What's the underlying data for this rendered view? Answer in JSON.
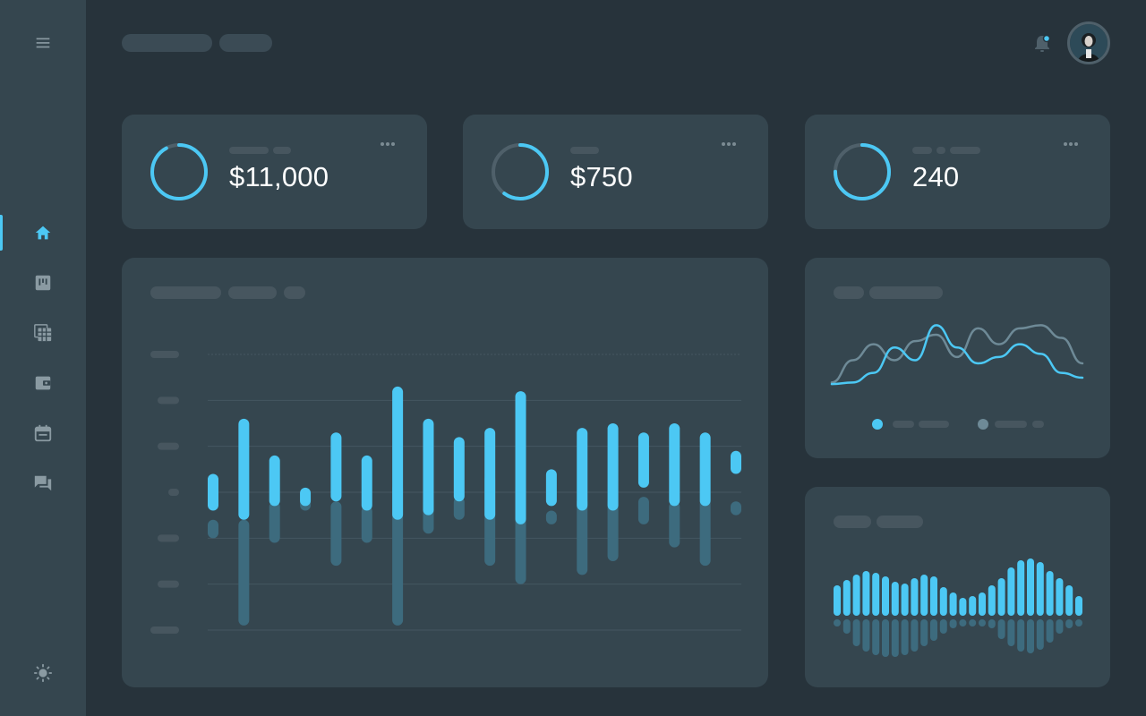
{
  "colors": {
    "accent": "#4cc8f4",
    "muted_series": "#3d6b7e",
    "background": "#27333b",
    "panel": "#35464f",
    "placeholder": "#47565f"
  },
  "sidebar": {
    "items": [
      {
        "icon": "menu-icon"
      },
      {
        "icon": "home-icon",
        "active": true
      },
      {
        "icon": "board-icon"
      },
      {
        "icon": "table-icon"
      },
      {
        "icon": "wallet-icon"
      },
      {
        "icon": "calendar-icon"
      },
      {
        "icon": "chat-icon"
      },
      {
        "icon": "brightness-icon"
      }
    ]
  },
  "header": {
    "notification_icon": "bell-icon",
    "notification_badge": true,
    "avatar": "user-avatar"
  },
  "stats": [
    {
      "value": "$11,000",
      "ring_progress": 0.92,
      "icon": "more-icon"
    },
    {
      "value": "$750",
      "ring_progress": 0.6,
      "icon": "more-icon"
    },
    {
      "value": "240",
      "ring_progress": 0.75,
      "icon": "more-icon"
    }
  ],
  "chart_data": [
    {
      "type": "bar",
      "series": [
        {
          "values": [
            [
              -1,
              -0.6
            ],
            [
              -2.9,
              -0.6
            ],
            [
              -1.1,
              -0.2
            ],
            [
              -0.4,
              -0.1
            ],
            [
              -1.6,
              -0.2
            ],
            [
              -1.1,
              -0.3
            ],
            [
              -2.9,
              0.2
            ],
            [
              -0.9,
              -0.1
            ],
            [
              -0.6,
              -0.1
            ],
            [
              -1.6,
              0.4
            ],
            [
              -2.0,
              0.2
            ],
            [
              -0.7,
              -0.4
            ],
            [
              -1.8,
              -0.1
            ],
            [
              -1.5,
              -0.1
            ],
            [
              -0.7,
              -0.1
            ],
            [
              -1.2,
              -0.2
            ],
            [
              -1.6,
              -0.1
            ],
            [
              -0.5,
              -0.2
            ]
          ]
        },
        {
          "values": [
            [
              -0.4,
              0.4
            ],
            [
              -0.6,
              1.6
            ],
            [
              -0.3,
              0.8
            ],
            [
              -0.3,
              0.1
            ],
            [
              -0.2,
              1.3
            ],
            [
              -0.4,
              0.8
            ],
            [
              -0.6,
              2.3
            ],
            [
              -0.5,
              1.6
            ],
            [
              -0.2,
              1.2
            ],
            [
              -0.6,
              1.4
            ],
            [
              -0.7,
              2.2
            ],
            [
              -0.3,
              0.5
            ],
            [
              -0.4,
              1.4
            ],
            [
              -0.4,
              1.5
            ],
            [
              0.1,
              1.3
            ],
            [
              -0.3,
              1.5
            ],
            [
              -0.3,
              1.3
            ],
            [
              0.4,
              0.9
            ]
          ]
        }
      ],
      "ylim": [
        -3,
        3
      ],
      "grid": true
    },
    {
      "type": "line",
      "series": [
        {
          "color": "#4cc8f4",
          "values": [
            5,
            6,
            12,
            28,
            20,
            42,
            28,
            18,
            22,
            30,
            24,
            12,
            9
          ]
        },
        {
          "color": "#6e8a97",
          "values": [
            6,
            20,
            30,
            20,
            32,
            36,
            22,
            40,
            30,
            40,
            42,
            34,
            18
          ]
        }
      ],
      "legend": "bottom"
    },
    {
      "type": "bar",
      "series": [
        {
          "color": "#4cc8f4",
          "values": [
            34,
            40,
            46,
            50,
            48,
            44,
            38,
            36,
            42,
            46,
            44,
            32,
            26,
            20,
            22,
            26,
            34,
            42,
            54,
            62,
            64,
            60,
            50,
            42,
            34,
            22
          ]
        },
        {
          "color": "#3d6b7e",
          "values": [
            8,
            16,
            30,
            36,
            40,
            42,
            42,
            40,
            36,
            30,
            24,
            16,
            10,
            8,
            6,
            8,
            10,
            22,
            30,
            36,
            38,
            34,
            26,
            16,
            10,
            8
          ]
        }
      ]
    }
  ]
}
